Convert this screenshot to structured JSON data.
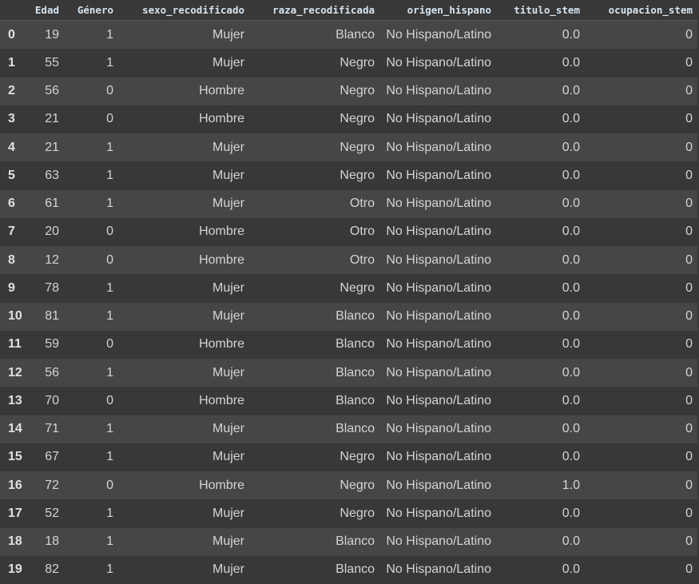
{
  "columns": [
    "",
    "Edad",
    "Género",
    "sexo_recodificado",
    "raza_recodificada",
    "origen_hispano",
    "titulo_stem",
    "ocupacion_stem"
  ],
  "rows": [
    [
      "0",
      "19",
      "1",
      "Mujer",
      "Blanco",
      "No Hispano/Latino",
      "0.0",
      "0"
    ],
    [
      "1",
      "55",
      "1",
      "Mujer",
      "Negro",
      "No Hispano/Latino",
      "0.0",
      "0"
    ],
    [
      "2",
      "56",
      "0",
      "Hombre",
      "Negro",
      "No Hispano/Latino",
      "0.0",
      "0"
    ],
    [
      "3",
      "21",
      "0",
      "Hombre",
      "Negro",
      "No Hispano/Latino",
      "0.0",
      "0"
    ],
    [
      "4",
      "21",
      "1",
      "Mujer",
      "Negro",
      "No Hispano/Latino",
      "0.0",
      "0"
    ],
    [
      "5",
      "63",
      "1",
      "Mujer",
      "Negro",
      "No Hispano/Latino",
      "0.0",
      "0"
    ],
    [
      "6",
      "61",
      "1",
      "Mujer",
      "Otro",
      "No Hispano/Latino",
      "0.0",
      "0"
    ],
    [
      "7",
      "20",
      "0",
      "Hombre",
      "Otro",
      "No Hispano/Latino",
      "0.0",
      "0"
    ],
    [
      "8",
      "12",
      "0",
      "Hombre",
      "Otro",
      "No Hispano/Latino",
      "0.0",
      "0"
    ],
    [
      "9",
      "78",
      "1",
      "Mujer",
      "Negro",
      "No Hispano/Latino",
      "0.0",
      "0"
    ],
    [
      "10",
      "81",
      "1",
      "Mujer",
      "Blanco",
      "No Hispano/Latino",
      "0.0",
      "0"
    ],
    [
      "11",
      "59",
      "0",
      "Hombre",
      "Blanco",
      "No Hispano/Latino",
      "0.0",
      "0"
    ],
    [
      "12",
      "56",
      "1",
      "Mujer",
      "Blanco",
      "No Hispano/Latino",
      "0.0",
      "0"
    ],
    [
      "13",
      "70",
      "0",
      "Hombre",
      "Blanco",
      "No Hispano/Latino",
      "0.0",
      "0"
    ],
    [
      "14",
      "71",
      "1",
      "Mujer",
      "Blanco",
      "No Hispano/Latino",
      "0.0",
      "0"
    ],
    [
      "15",
      "67",
      "1",
      "Mujer",
      "Negro",
      "No Hispano/Latino",
      "0.0",
      "0"
    ],
    [
      "16",
      "72",
      "0",
      "Hombre",
      "Negro",
      "No Hispano/Latino",
      "1.0",
      "0"
    ],
    [
      "17",
      "52",
      "1",
      "Mujer",
      "Negro",
      "No Hispano/Latino",
      "0.0",
      "0"
    ],
    [
      "18",
      "18",
      "1",
      "Mujer",
      "Blanco",
      "No Hispano/Latino",
      "0.0",
      "0"
    ],
    [
      "19",
      "82",
      "1",
      "Mujer",
      "Blanco",
      "No Hispano/Latino",
      "0.0",
      "0"
    ]
  ]
}
